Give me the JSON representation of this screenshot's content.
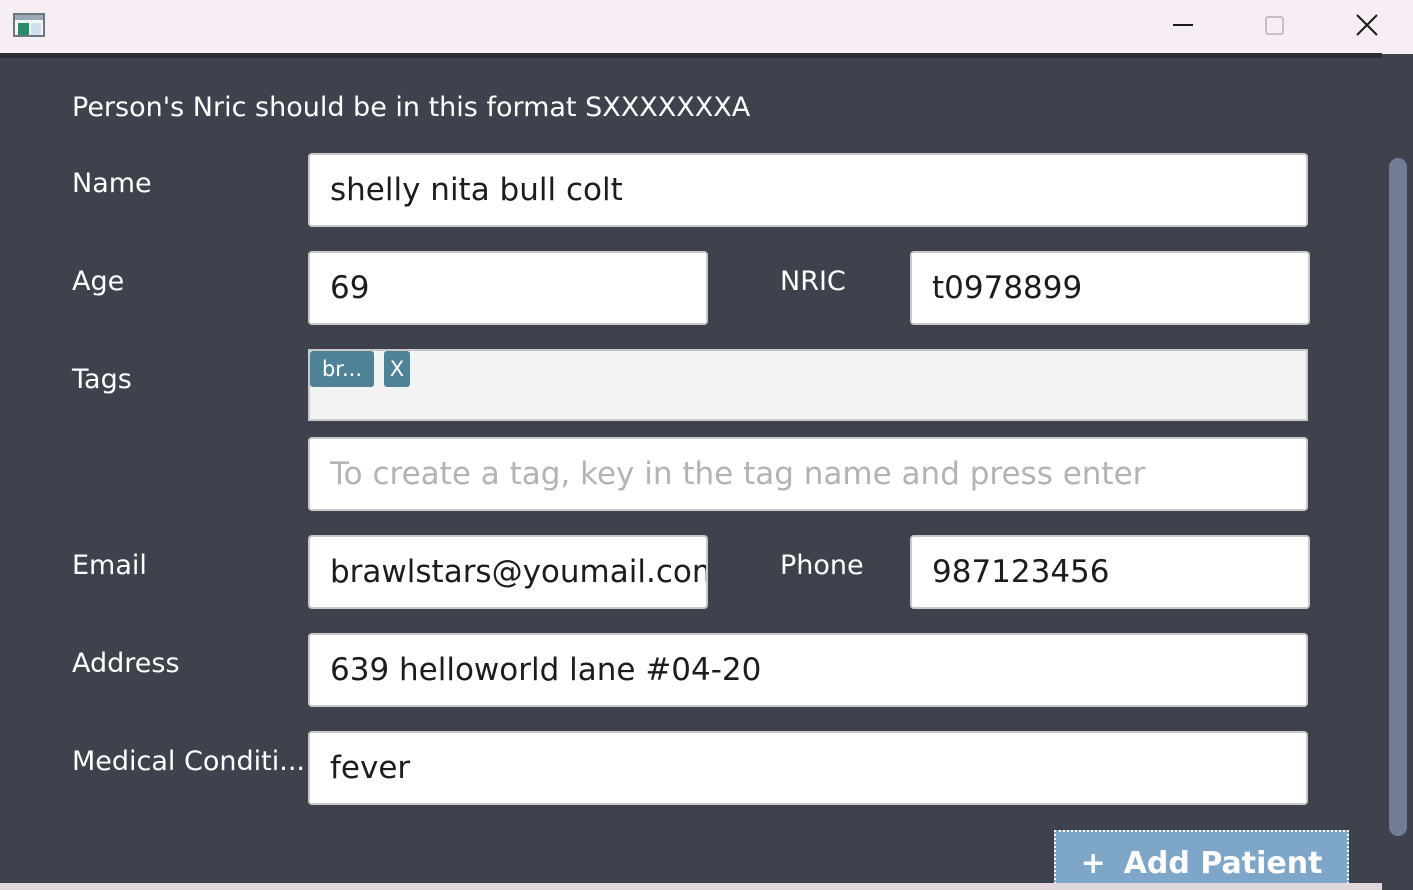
{
  "window": {
    "minimize_glyph": "—",
    "maximize_glyph": "☐",
    "close_glyph": "✕"
  },
  "form": {
    "nric_hint": "Person's Nric should be in this format SXXXXXXXA",
    "name": {
      "label": "Name",
      "value": "shelly nita bull colt"
    },
    "age": {
      "label": "Age",
      "value": "69"
    },
    "nric": {
      "label": "NRIC",
      "value": "t0978899"
    },
    "tags": {
      "label": "Tags",
      "items": [
        {
          "text": "br...",
          "remove_label": "X"
        }
      ],
      "input_placeholder": "To create a tag, key in the tag name and press enter"
    },
    "email": {
      "label": "Email",
      "value": "brawlstars@youmail.com"
    },
    "phone": {
      "label": "Phone",
      "value": "987123456"
    },
    "address": {
      "label": "Address",
      "value": "639 helloworld lane #04-20"
    },
    "medical": {
      "label": "Medical Conditi...",
      "value": "fever"
    },
    "submit": {
      "icon": "+",
      "label": "Add Patient"
    }
  },
  "colors": {
    "background": "#3d424d",
    "tag_chip": "#4e8397",
    "button": "#7ea6c9",
    "scroll_thumb": "#737c97"
  }
}
